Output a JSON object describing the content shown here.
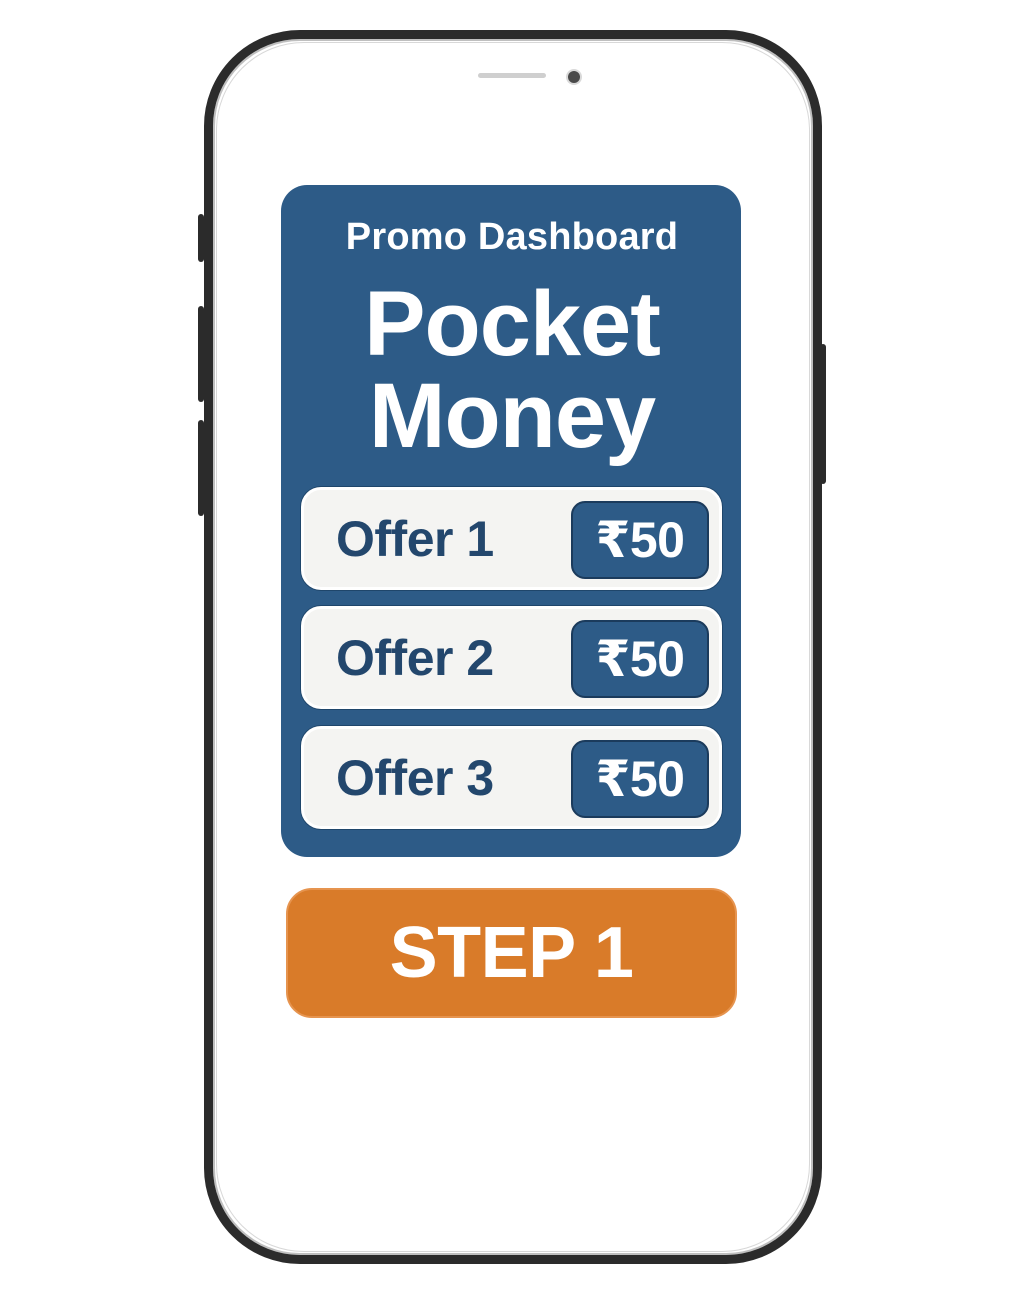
{
  "screen": {
    "header": "Promo Dashboard",
    "headline_line1": "Pocket",
    "headline_line2": "Money"
  },
  "offers": [
    {
      "label": "Offer 1",
      "amount": "₹50"
    },
    {
      "label": "Offer 2",
      "amount": "₹50"
    },
    {
      "label": "Offer 3",
      "amount": "₹50"
    }
  ],
  "step_button": {
    "label": "STEP 1"
  },
  "colors": {
    "card": "#2d5b87",
    "offer_text": "#23476d",
    "offer_bg": "#f4f4f2",
    "step_button": "#d97b29",
    "phone_frame": "#2b2b2b"
  },
  "icons": {
    "camera": "front-camera-icon",
    "speaker": "speaker-grille-icon"
  }
}
